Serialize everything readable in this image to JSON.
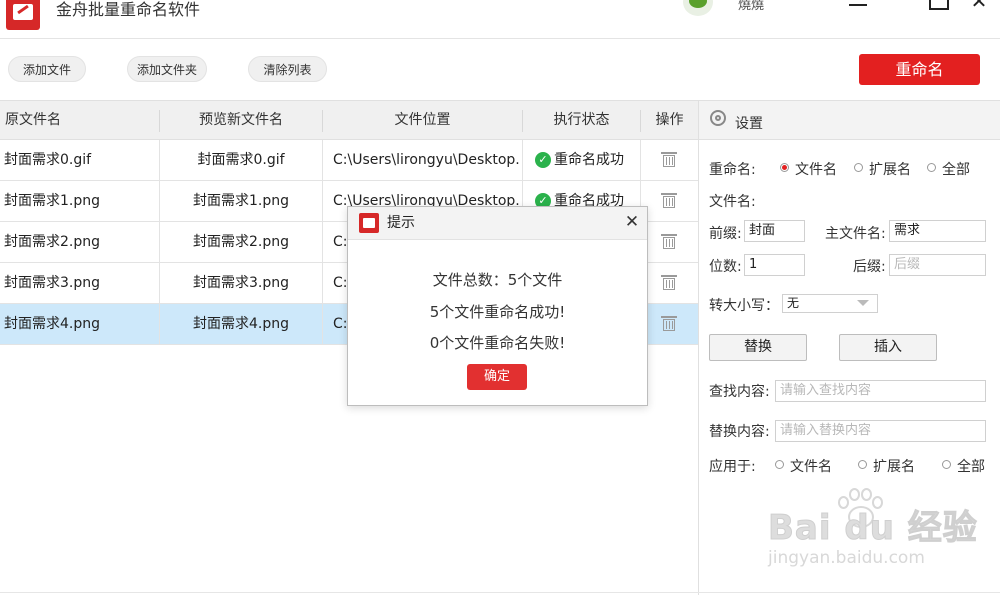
{
  "app": {
    "title": "金舟批量重命名软件",
    "user_name": "燒燒"
  },
  "toolbar": {
    "add_file": "添加文件",
    "add_folder": "添加文件夹",
    "clear_list": "清除列表",
    "rename": "重命名"
  },
  "table": {
    "columns": [
      "原文件名",
      "预览新文件名",
      "文件位置",
      "执行状态",
      "操作"
    ],
    "rows": [
      {
        "orig": "封面需求0.gif",
        "preview": "封面需求0.gif",
        "location": "C:\\Users\\lirongyu\\Desktop...",
        "status": "重命名成功"
      },
      {
        "orig": "封面需求1.png",
        "preview": "封面需求1.png",
        "location": "C:\\Users\\lirongyu\\Desktop...",
        "status": "重命名成功"
      },
      {
        "orig": "封面需求2.png",
        "preview": "封面需求2.png",
        "location": "C:",
        "status": ""
      },
      {
        "orig": "封面需求3.png",
        "preview": "封面需求3.png",
        "location": "C:",
        "status": ""
      },
      {
        "orig": "封面需求4.png",
        "preview": "封面需求4.png",
        "location": "C:",
        "status": ""
      }
    ],
    "selected_row": 4
  },
  "settings": {
    "header": "设置",
    "rename_label": "重命名:",
    "rename_options": [
      "文件名",
      "扩展名",
      "全部"
    ],
    "rename_selected": 0,
    "filename_label": "文件名:",
    "prefix_label": "前缀:",
    "prefix_value": "封面",
    "main_name_label": "主文件名:",
    "main_name_value": "需求",
    "digits_label": "位数:",
    "digits_value": "1",
    "suffix_label": "后缀:",
    "suffix_placeholder": "后缀",
    "case_label": "转大小写：",
    "case_value": "无",
    "replace_button": "替换",
    "insert_button": "插入",
    "find_label": "查找内容:",
    "find_placeholder": "请输入查找内容",
    "replace_label": "替换内容:",
    "replace_placeholder": "请输入替换内容",
    "apply_label": "应用于:",
    "apply_options": [
      "文件名",
      "扩展名",
      "全部"
    ]
  },
  "dialog": {
    "title": "提示",
    "line1": "文件总数：5个文件",
    "line2": "5个文件重命名成功!",
    "line3": "0个文件重命名失败!",
    "ok": "确定"
  },
  "watermark": {
    "text": "Bai du 经验",
    "url": "jingyan.baidu.com"
  },
  "colors": {
    "accent": "#e32020",
    "selected_row": "#cde8fa",
    "success": "#2bb24c"
  }
}
